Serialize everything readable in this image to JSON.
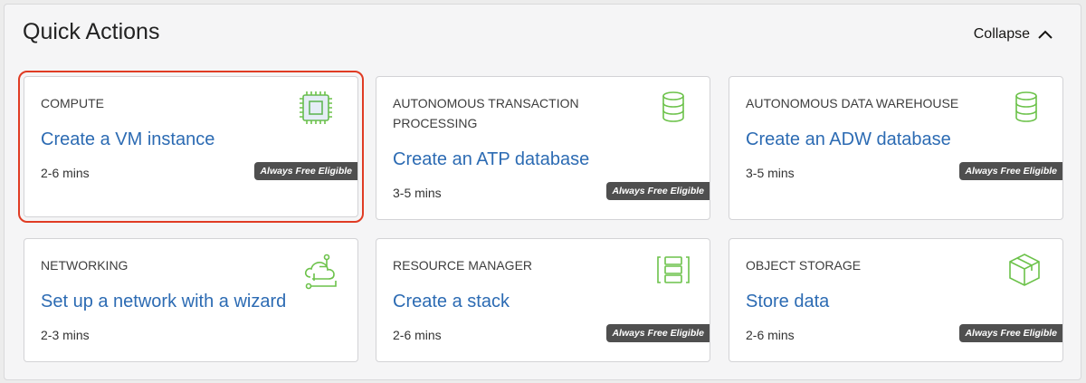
{
  "header": {
    "title": "Quick Actions",
    "collapse_label": "Collapse",
    "collapse_icon": "chevron-up-icon"
  },
  "cards": [
    {
      "category": "COMPUTE",
      "action": "Create a VM instance",
      "time": "2-6 mins",
      "badge": "Always Free Eligible",
      "icon": "cpu-chip-icon",
      "selected": true
    },
    {
      "category": "AUTONOMOUS TRANSACTION PROCESSING",
      "action": "Create an ATP database",
      "time": "3-5 mins",
      "badge": "Always Free Eligible",
      "icon": "database-icon"
    },
    {
      "category": "AUTONOMOUS DATA WAREHOUSE",
      "action": "Create an ADW database",
      "time": "3-5 mins",
      "badge": "Always Free Eligible",
      "icon": "database-icon"
    },
    {
      "category": "NETWORKING",
      "action": "Set up a network with a wizard",
      "time": "2-3 mins",
      "icon": "network-icon"
    },
    {
      "category": "RESOURCE MANAGER",
      "action": "Create a stack",
      "time": "2-6 mins",
      "badge": "Always Free Eligible",
      "icon": "stack-icon"
    },
    {
      "category": "OBJECT STORAGE",
      "action": "Store data",
      "time": "2-6 mins",
      "badge": "Always Free Eligible",
      "icon": "storage-box-icon"
    }
  ],
  "colors": {
    "accent": "#2c6bb3",
    "icon_green": "#6cc24a",
    "highlight": "#e03c24"
  }
}
